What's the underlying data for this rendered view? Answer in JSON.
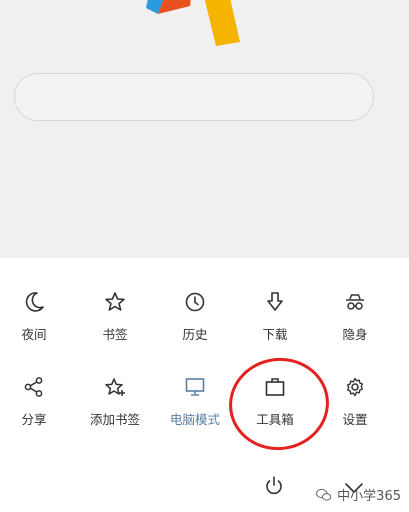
{
  "menu": {
    "row1": [
      {
        "label": "夜间",
        "icon": "moon-icon"
      },
      {
        "label": "书签",
        "icon": "star-icon"
      },
      {
        "label": "历史",
        "icon": "clock-icon"
      },
      {
        "label": "下载",
        "icon": "download-arrow-icon"
      },
      {
        "label": "隐身",
        "icon": "incognito-icon"
      }
    ],
    "row2": [
      {
        "label": "分享",
        "icon": "share-icon"
      },
      {
        "label": "添加书签",
        "icon": "star-plus-icon"
      },
      {
        "label": "电脑模式",
        "icon": "monitor-icon",
        "active": true
      },
      {
        "label": "工具箱",
        "icon": "toolbox-icon"
      },
      {
        "label": "设置",
        "icon": "gear-icon"
      }
    ],
    "bottom": [
      {
        "icon": "power-icon"
      },
      {
        "icon": "chevron-down-icon"
      }
    ]
  },
  "watermark": {
    "text": "中小学365",
    "icon": "wechat-icon"
  },
  "colors": {
    "active_label": "#5b7fa6",
    "highlight_ring": "#e4211c",
    "logo_blue": "#2a9be0",
    "logo_red": "#e8501d",
    "logo_yellow": "#f4b400"
  }
}
